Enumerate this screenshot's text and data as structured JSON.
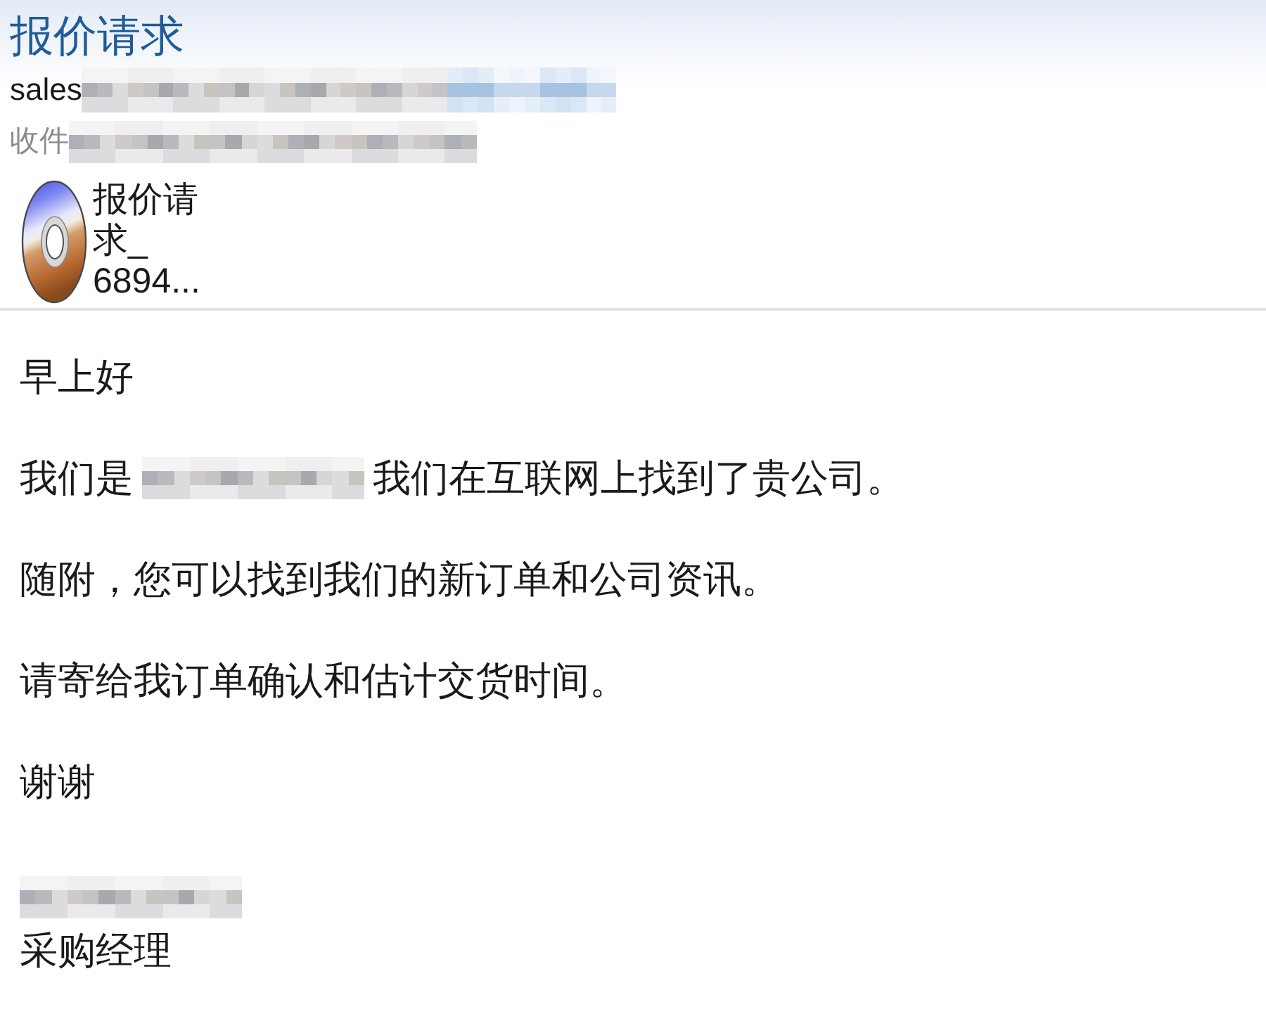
{
  "message": {
    "subject": "报价请求",
    "sender": [
      {
        "kind": "text",
        "text": "sales"
      },
      {
        "kind": "redacted"
      },
      {
        "kind": "redacted_link"
      }
    ],
    "recipients": [
      {
        "kind": "label",
        "text": "收件"
      },
      {
        "kind": "redacted"
      }
    ],
    "attachments": [
      {
        "name_lines": [
          "报价请",
          "求_",
          "6894..."
        ]
      }
    ],
    "body": [
      {
        "segments": [
          {
            "kind": "text",
            "text": "早上好"
          }
        ]
      },
      {
        "segments": [
          {
            "kind": "text",
            "text": "我们是"
          },
          {
            "kind": "redacted"
          },
          {
            "kind": "text",
            "text": "我们在互联网上找到了贵公司。"
          }
        ]
      },
      {
        "segments": [
          {
            "kind": "text",
            "text": "随附，您可以找到我们的新订单和公司资讯。"
          }
        ]
      },
      {
        "segments": [
          {
            "kind": "text",
            "text": "请寄给我订单确认和估计交货时间。"
          }
        ]
      },
      {
        "segments": [
          {
            "kind": "text",
            "text": "谢谢"
          }
        ]
      }
    ],
    "signature": [
      {
        "segments": [
          {
            "kind": "redacted"
          }
        ]
      },
      {
        "segments": [
          {
            "kind": "text",
            "text": "采购经理"
          }
        ]
      }
    ]
  }
}
